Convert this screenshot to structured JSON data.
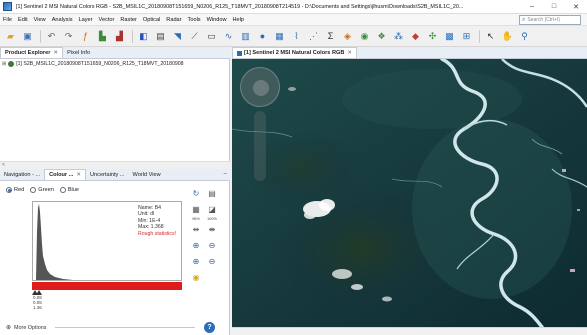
{
  "window": {
    "title": "[1] Sentinel 2 MSI Natural Colors RGB - S2B_MSIL1C_20180908T151659_N0206_R125_T18MVT_20180908T214519 - D:\\Documents and Settings\\jlhusm\\Downloads\\S2B_MSIL1C_20...",
    "minimize": "–",
    "maximize": "□",
    "close": "✕"
  },
  "menubar": {
    "items": [
      "File",
      "Edit",
      "View",
      "Analysis",
      "Layer",
      "Vector",
      "Raster",
      "Optical",
      "Radar",
      "Tools",
      "Window",
      "Help"
    ],
    "search_placeholder": "Search (Ctrl+I)"
  },
  "product_explorer": {
    "tabs": [
      {
        "label": "Product Explorer",
        "close": "✕"
      },
      {
        "label": "Pixel Info"
      }
    ],
    "tree_item": "[1] S2B_MSIL1C_20180908T151659_N0206_R125_T18MVT_20180908",
    "scroll_left": "<"
  },
  "lower_panel": {
    "tabs": [
      {
        "label": "Navigation - ..."
      },
      {
        "label": "Colour ...",
        "close": "✕"
      },
      {
        "label": "Uncertainty ..."
      },
      {
        "label": "World View"
      }
    ],
    "minimize": "–",
    "channels": [
      {
        "label": "Red",
        "selected": true
      },
      {
        "label": "Green",
        "selected": false
      },
      {
        "label": "Blue",
        "selected": false
      }
    ],
    "histogram_info": {
      "name": "Name: B4",
      "unit": "Unit: dl",
      "min": "Min: 1E-4",
      "max": "Max: 1.368",
      "warning": "Rough statistics!"
    },
    "slider_labels": [
      "0.08",
      "0.05",
      "1.36"
    ],
    "side_tool_labels": [
      "95%",
      "100%"
    ],
    "more_options": "More Options",
    "help": "?"
  },
  "image_view": {
    "tab_label": "[1] Sentinel 2 MSI Natural Colors RGB",
    "tab_close": "✕"
  },
  "colors": {
    "accent": "#2a6db8",
    "stretch_bar": "#e01b1b",
    "warning_text": "#d12a2a"
  }
}
